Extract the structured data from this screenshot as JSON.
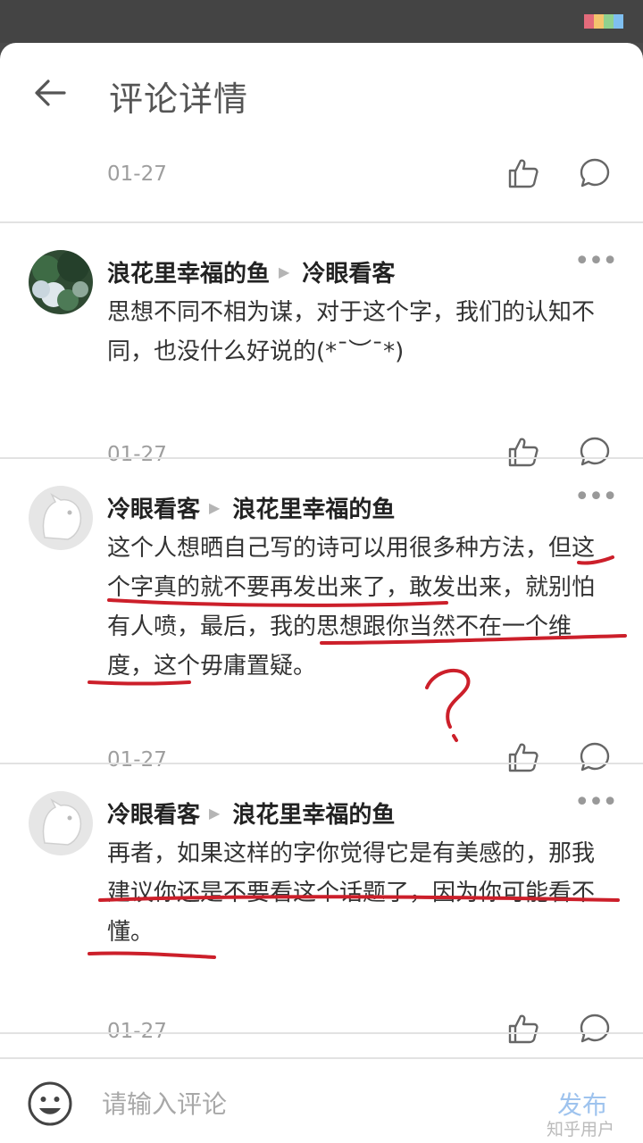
{
  "header": {
    "title": "评论详情"
  },
  "top_row": {
    "date": "01-27"
  },
  "comments": [
    {
      "author": "浪花里幸福的鱼",
      "reply_to": "冷眼看客",
      "text": "思想不同不相为谋，对于这个字，我们的认知不同，也没什么好说的(*¯︶¯*)",
      "date": "01-27",
      "more": "•••"
    },
    {
      "author": "冷眼看客",
      "reply_to": "浪花里幸福的鱼",
      "text": "这个人想晒自己写的诗可以用很多种方法，但这个字真的就不要再发出来了，敢发出来，就别怕有人喷，最后，我的思想跟你当然不在一个维度，这个毋庸置疑。",
      "date": "01-27",
      "more": "•••"
    },
    {
      "author": "冷眼看客",
      "reply_to": "浪花里幸福的鱼",
      "text": "再者，如果这样的字你觉得它是有美感的，那我建议你还是不要看这个话题了，因为你可能看不懂。",
      "date": "01-27",
      "more": "•••"
    }
  ],
  "input_bar": {
    "placeholder": "请输入评论",
    "publish": "发布",
    "watermark": "知乎用户"
  },
  "colors": {
    "accent_disabled": "#9ec3ee",
    "annotation": "#cc1f2a"
  },
  "icons": [
    "back-arrow-icon",
    "like-icon",
    "reply-icon",
    "more-icon",
    "emoji-icon"
  ]
}
